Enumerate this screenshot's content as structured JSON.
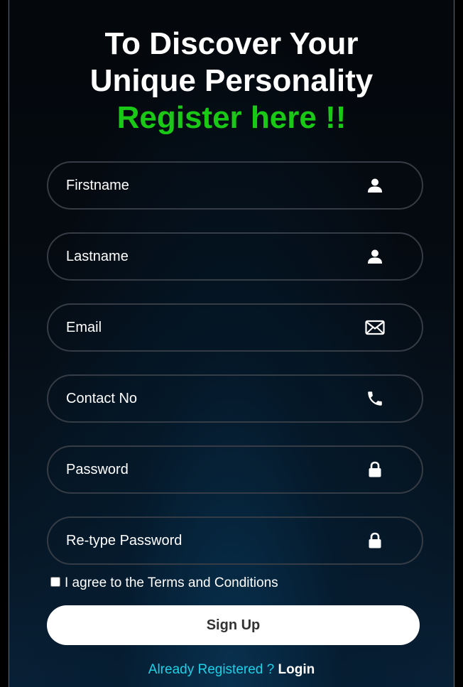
{
  "heading": {
    "line1": "To Discover Your",
    "line2": "Unique Personality",
    "line3": "Register here !!"
  },
  "form": {
    "fields": [
      {
        "placeholder": "Firstname",
        "value": "",
        "icon": "user-icon"
      },
      {
        "placeholder": "Lastname",
        "value": "",
        "icon": "user-icon"
      },
      {
        "placeholder": "Email",
        "value": "",
        "icon": "envelope-icon"
      },
      {
        "placeholder": "Contact No",
        "value": "",
        "icon": "phone-icon"
      },
      {
        "placeholder": "Password",
        "value": "",
        "icon": "lock-icon"
      },
      {
        "placeholder": "Re-type Password",
        "value": "",
        "icon": "lock-icon"
      }
    ],
    "terms_label": "I agree to the Terms and Conditions",
    "terms_checked": false,
    "submit_label": "Sign Up"
  },
  "footer": {
    "prompt": "Already Registered ?",
    "login_label": "Login"
  },
  "colors": {
    "accent_green": "#19c916",
    "prompt_cyan": "#1fd1e6",
    "field_border": "#353c45"
  }
}
